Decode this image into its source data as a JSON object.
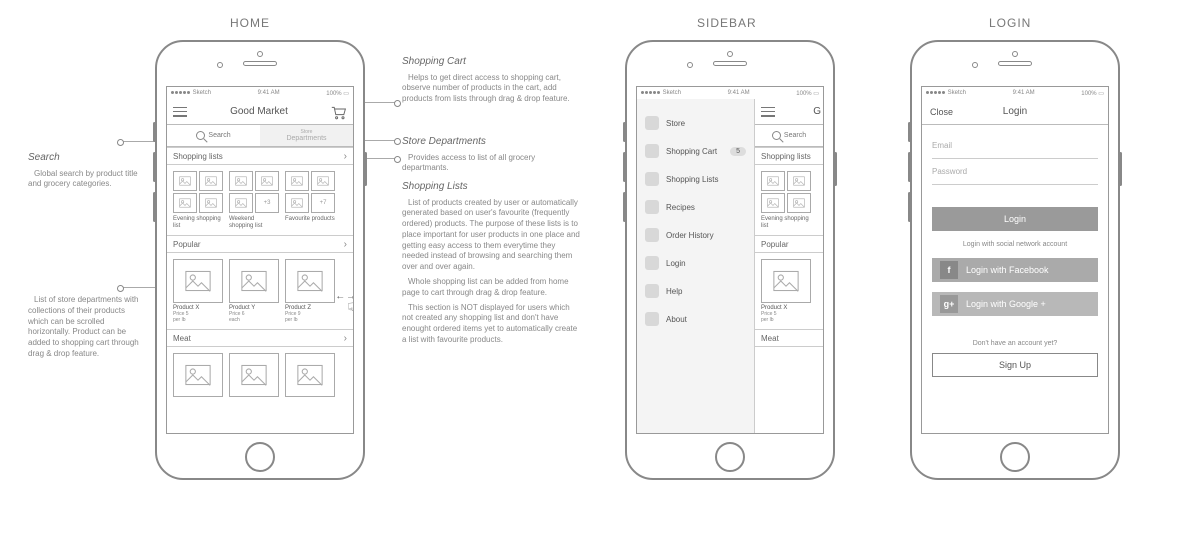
{
  "headings": {
    "home": "HOME",
    "sidebar": "SIDEBAR",
    "login": "LOGIN"
  },
  "status": {
    "carrier": "Sketch",
    "time": "9:41 AM",
    "battery": "100%"
  },
  "home": {
    "title": "Good Market",
    "tabs": {
      "search": "Search",
      "departments_top": "Store",
      "departments": "Departments"
    },
    "sections": {
      "shopping_lists": "Shopping lists",
      "popular": "Popular",
      "meat": "Meat"
    },
    "lists": [
      {
        "name": "Evening shopping list",
        "extra": ""
      },
      {
        "name": "Weekend shopping list",
        "extra": "+3"
      },
      {
        "name": "Favourite products",
        "extra": "+7"
      }
    ],
    "products": [
      {
        "name": "Product X",
        "price": "Price 5",
        "qty": "per lb"
      },
      {
        "name": "Product Y",
        "price": "Price 6",
        "qty": "each"
      },
      {
        "name": "Product Z",
        "price": "Price 9",
        "qty": "per lb"
      }
    ]
  },
  "sidebar": {
    "search_placeholder": "Search",
    "items": [
      {
        "label": "Store",
        "badge": ""
      },
      {
        "label": "Shopping Cart",
        "badge": "5"
      },
      {
        "label": "Shopping Lists",
        "badge": ""
      },
      {
        "label": "Recipes",
        "badge": ""
      },
      {
        "label": "Order History",
        "badge": ""
      },
      {
        "label": "Login",
        "badge": ""
      },
      {
        "label": "Help",
        "badge": ""
      },
      {
        "label": "About",
        "badge": ""
      }
    ],
    "peek": {
      "title_initial": "G",
      "shopping_head": "Shopping lists",
      "popular": "Popular",
      "meat": "Meat"
    }
  },
  "login": {
    "close": "Close",
    "title": "Login",
    "email": "Email",
    "password": "Password",
    "login_btn": "Login",
    "social_caption": "Login with social network account",
    "fb": "Login with Facebook",
    "gp": "Login with Google +",
    "signup_caption": "Don't have an account yet?",
    "signup_btn": "Sign Up"
  },
  "annotations": {
    "search": {
      "title": "Search",
      "body": "Global search by product title and grocery categories."
    },
    "dept_list": {
      "body": "List of store departments with collections of their products which can be scrolled horizontally. Product can be added to shopping cart through drag & drop feature."
    },
    "cart": {
      "title": "Shopping Cart",
      "body": "Helps to get direct access to shopping cart, observe number of products in the cart, add products from lists through drag & drop feature."
    },
    "departments": {
      "title": "Store Departments",
      "body": "Provides access to list of all grocery departmants."
    },
    "lists": {
      "title": "Shopping Lists",
      "p1": "List of products created by user or automatically generated based on user's favourite (frequently ordered) products. The purpose of these lists is to place important for user products in one place and getting easy access to them everytime they needed instead of browsing and searching them over and over again.",
      "p2": "Whole shopping list can be added from home page to cart through drag & drop feature.",
      "p3": "This section is NOT displayed for users which not created any shopping list and don't have enought ordered items yet to automatically create a list with favourite products."
    }
  }
}
